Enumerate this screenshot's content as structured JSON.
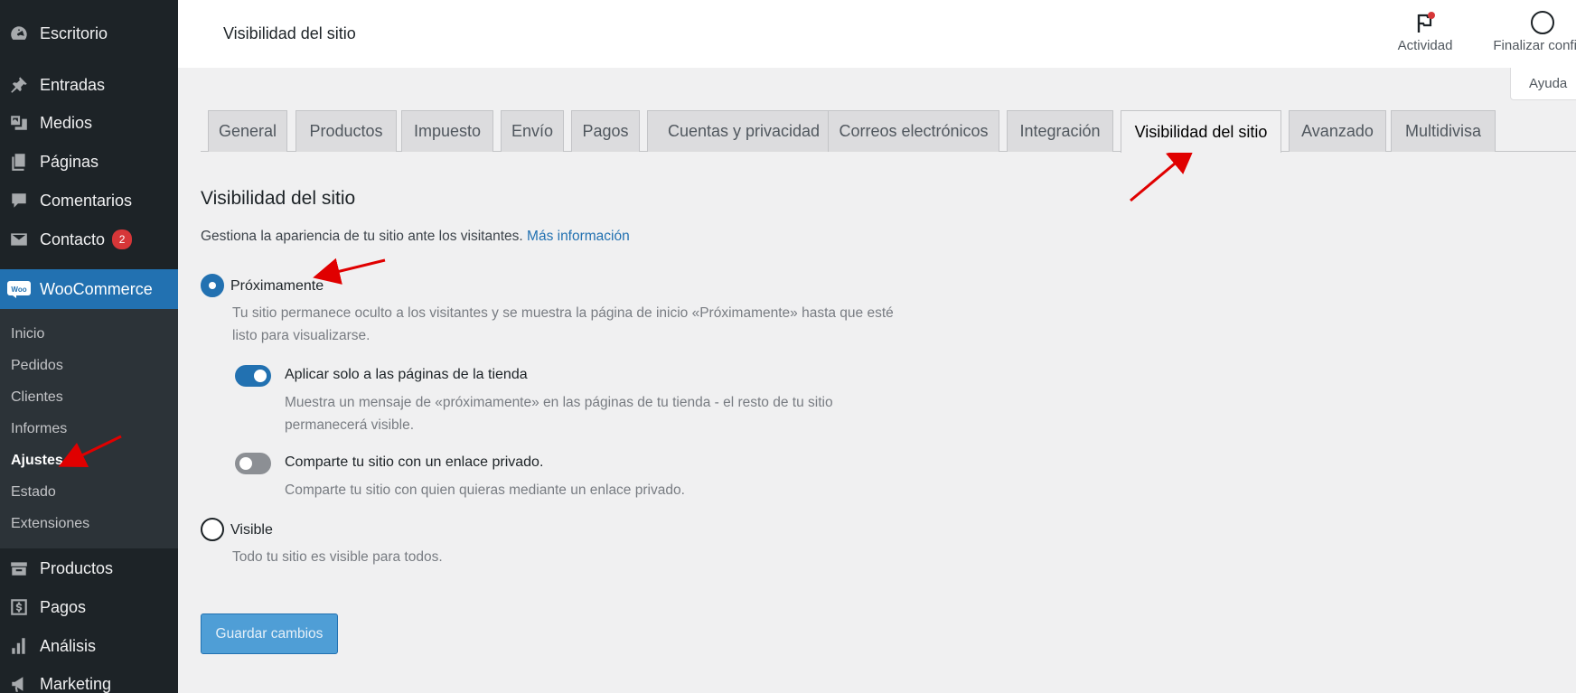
{
  "sidebar": {
    "items": [
      {
        "label": "Escritorio",
        "icon": "dashboard-icon"
      },
      {
        "label": "Entradas",
        "icon": "pin-icon"
      },
      {
        "label": "Medios",
        "icon": "media-icon"
      },
      {
        "label": "Páginas",
        "icon": "pages-icon"
      },
      {
        "label": "Comentarios",
        "icon": "comments-icon"
      },
      {
        "label": "Contacto",
        "icon": "mail-icon",
        "badge": "2"
      },
      {
        "label": "WooCommerce",
        "icon": "woocommerce-icon"
      },
      {
        "label": "Productos",
        "icon": "products-icon"
      },
      {
        "label": "Pagos",
        "icon": "payments-icon"
      },
      {
        "label": "Análisis",
        "icon": "analytics-icon"
      },
      {
        "label": "Marketing",
        "icon": "megaphone-icon"
      }
    ],
    "woo_logo_text": "Woo",
    "submenu": [
      "Inicio",
      "Pedidos",
      "Clientes",
      "Informes",
      "Ajustes",
      "Estado",
      "Extensiones"
    ]
  },
  "header": {
    "title": "Visibilidad del sitio",
    "activity_label": "Actividad",
    "finish_label": "Finalizar configu",
    "help_label": "Ayuda"
  },
  "tabs": [
    "General",
    "Productos",
    "Impuesto",
    "Envío",
    "Pagos",
    "Cuentas y privacidad",
    "Correos electrónicos",
    "Integración",
    "Visibilidad del sitio",
    "Avanzado",
    "Multidivisa"
  ],
  "active_tab": "Visibilidad del sitio",
  "content": {
    "title": "Visibilidad del sitio",
    "intro": "Gestiona la apariencia de tu sitio ante los visitantes.",
    "intro_link": "Más información",
    "coming_soon": {
      "label": "Próximamente",
      "desc_line1": "Tu sitio permanece oculto a los visitantes y se muestra la página de inicio «Próximamente» hasta que esté",
      "desc_line2": "listo para visualizarse.",
      "selected": true
    },
    "store_only": {
      "label": "Aplicar solo a las páginas de la tienda",
      "desc_line1": "Muestra un mensaje de «próximamente» en las páginas de tu tienda - el resto de tu sitio",
      "desc_line2": "permanecerá visible.",
      "enabled": true
    },
    "private_link": {
      "label": "Comparte tu sitio con un enlace privado.",
      "desc": "Comparte tu sitio con quien quieras mediante un enlace privado.",
      "enabled": false
    },
    "visible": {
      "label": "Visible",
      "desc": "Todo tu sitio es visible para todos.",
      "selected": false
    },
    "save_label": "Guardar cambios"
  },
  "colors": {
    "accent": "#2271b1",
    "sidebar_bg": "#1d2327",
    "annotation_arrow": "#e00000"
  }
}
